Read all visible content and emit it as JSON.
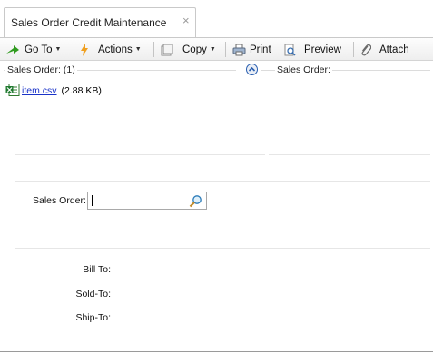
{
  "tab": {
    "title": "Sales Order Credit Maintenance",
    "close_glyph": "×"
  },
  "toolbar": {
    "goto_label": "Go To",
    "actions_label": "Actions",
    "copy_label": "Copy",
    "print_label": "Print",
    "preview_label": "Preview",
    "attach_label": "Attach"
  },
  "attachments": {
    "section_label": "Sales Order: (1)",
    "file_name": "item.csv",
    "file_size": "(2.88 KB)"
  },
  "right_section": {
    "label": "Sales Order:"
  },
  "form": {
    "sales_order_label": "Sales Order:",
    "sales_order_value": "",
    "bill_to_label": "Bill To:",
    "sold_to_label": "Sold-To:",
    "ship_to_label": "Ship-To:"
  },
  "colors": {
    "accent_green": "#2f9a1e",
    "link_blue": "#1a33c8",
    "collapse_blue": "#2a5fb0"
  }
}
